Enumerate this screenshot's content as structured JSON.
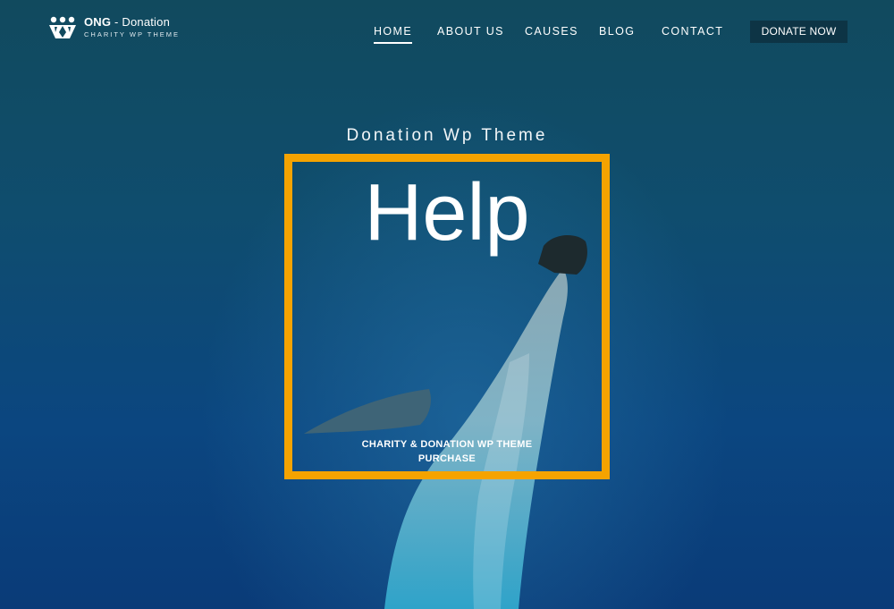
{
  "brand": {
    "name_bold": "ONG",
    "name_rest": " - Donation",
    "tagline": "CHARITY WP THEME",
    "logo_icon": "hearts-people-logo-icon"
  },
  "nav": {
    "items": [
      {
        "label": "HOME",
        "active": true
      },
      {
        "label": "ABOUT US",
        "active": false
      },
      {
        "label": "CAUSES",
        "active": false
      },
      {
        "label": "BLOG",
        "active": false
      },
      {
        "label": "CONTACT",
        "active": false
      }
    ],
    "donate_label": "DONATE NOW"
  },
  "hero": {
    "subtitle": "Donation Wp Theme",
    "title": "Help",
    "cta_line1": "CHARITY & DONATION WP THEME",
    "cta_line2": "PURCHASE",
    "background_image": "dolphin-underwater-photo"
  },
  "colors": {
    "accent": "#f5a300",
    "background_top": "#114a5e",
    "background_bottom": "#0a3b78",
    "button_bg": "#0d3445"
  }
}
